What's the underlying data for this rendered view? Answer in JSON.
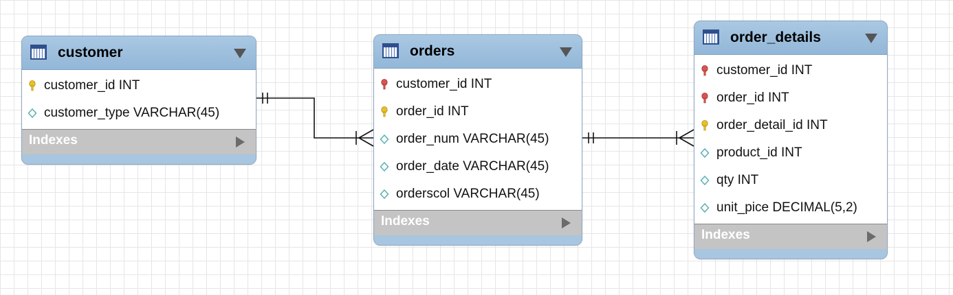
{
  "tables": {
    "customer": {
      "name": "customer",
      "columns": [
        {
          "text": "customer_id INT",
          "icon": "primary-key-icon"
        },
        {
          "text": "customer_type VARCHAR(45)",
          "icon": "column-diamond-icon"
        }
      ],
      "indexes_label": "Indexes"
    },
    "orders": {
      "name": "orders",
      "columns": [
        {
          "text": "customer_id INT",
          "icon": "foreign-key-icon"
        },
        {
          "text": "order_id INT",
          "icon": "primary-key-icon"
        },
        {
          "text": "order_num VARCHAR(45)",
          "icon": "column-diamond-icon"
        },
        {
          "text": "order_date VARCHAR(45)",
          "icon": "column-diamond-icon"
        },
        {
          "text": "orderscol VARCHAR(45)",
          "icon": "column-diamond-icon"
        }
      ],
      "indexes_label": "Indexes"
    },
    "order_details": {
      "name": "order_details",
      "columns": [
        {
          "text": "customer_id INT",
          "icon": "foreign-key-icon"
        },
        {
          "text": "order_id INT",
          "icon": "foreign-key-icon"
        },
        {
          "text": "order_detail_id INT",
          "icon": "primary-key-icon"
        },
        {
          "text": "product_id INT",
          "icon": "column-diamond-icon"
        },
        {
          "text": "qty INT",
          "icon": "column-diamond-icon"
        },
        {
          "text": "unit_pice DECIMAL(5,2)",
          "icon": "column-diamond-icon"
        }
      ],
      "indexes_label": "Indexes"
    }
  },
  "relationships": [
    {
      "from": "customer",
      "to": "orders",
      "from_cardinality": "one-and-only-one",
      "to_cardinality": "one-or-many"
    },
    {
      "from": "orders",
      "to": "order_details",
      "from_cardinality": "one-and-only-one",
      "to_cardinality": "one-or-many"
    }
  ],
  "colors": {
    "header": "#a9c8e3",
    "table_icon": "#2f4e8c",
    "primary_key": "#e8c02a",
    "foreign_key": "#d9534f",
    "column_diamond": "#5fb3b3",
    "indexes_bar": "#c4c4c4"
  }
}
